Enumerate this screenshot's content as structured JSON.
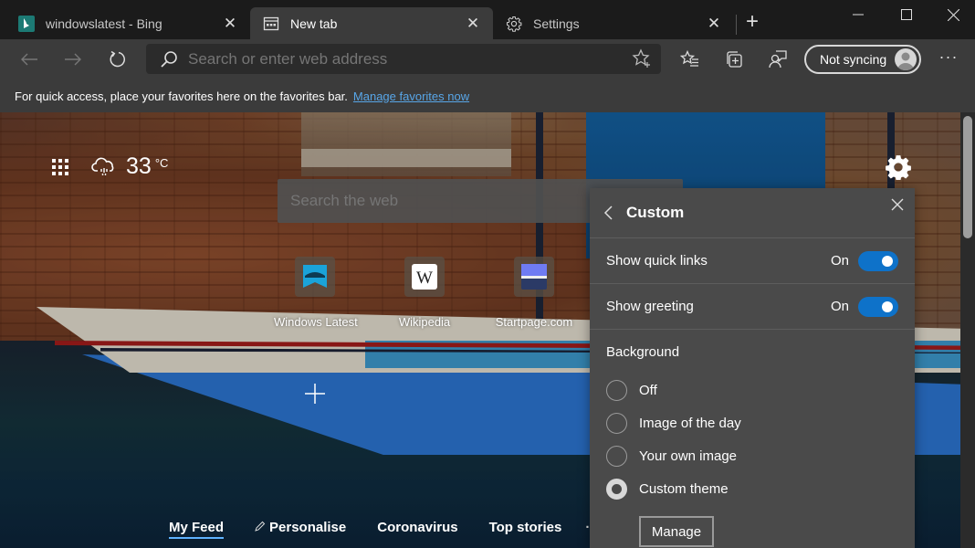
{
  "tabs": [
    {
      "label": "windowslatest - Bing",
      "icon": "bing-icon",
      "active": false
    },
    {
      "label": "New tab",
      "icon": "newtab-icon",
      "active": true
    },
    {
      "label": "Settings",
      "icon": "gear-icon",
      "active": false
    }
  ],
  "window_controls": {
    "minimize": "minimize",
    "maximize": "maximize",
    "close": "close"
  },
  "toolbar": {
    "address_placeholder": "Search or enter web address",
    "address_value": "",
    "sync_label": "Not syncing",
    "more_label": "···"
  },
  "favorites_bar": {
    "message": "For quick access, place your favorites here on the favorites bar.",
    "link": "Manage favorites now"
  },
  "newtab": {
    "weather": {
      "temperature": "33",
      "unit": "°C",
      "icon": "cloud-rain-icon"
    },
    "search_placeholder": "Search the web",
    "quick_links": [
      {
        "label": "Windows Latest",
        "icon": "windows-latest-icon"
      },
      {
        "label": "Wikipedia",
        "icon": "wikipedia-icon"
      },
      {
        "label": "Startpage.com",
        "icon": "startpage-icon"
      }
    ],
    "feed_nav": [
      {
        "label": "My Feed",
        "active": true
      },
      {
        "label": "Personalise",
        "icon": "pencil-icon"
      },
      {
        "label": "Coronavirus"
      },
      {
        "label": "Top stories"
      }
    ],
    "feed_more": "··"
  },
  "panel": {
    "title": "Custom",
    "toggles": [
      {
        "label": "Show quick links",
        "state": "On",
        "on": true
      },
      {
        "label": "Show greeting",
        "state": "On",
        "on": true
      }
    ],
    "background_heading": "Background",
    "background_options": [
      {
        "label": "Off",
        "checked": false
      },
      {
        "label": "Image of the day",
        "checked": false
      },
      {
        "label": "Your own image",
        "checked": false
      },
      {
        "label": "Custom theme",
        "checked": true
      }
    ],
    "manage_label": "Manage"
  },
  "colors": {
    "accent": "#0e72c9",
    "link": "#58a6e8",
    "panel_bg": "#4a4a4a",
    "toolbar_bg": "#3b3b3b",
    "titlebar_bg": "#1b1b1b"
  }
}
